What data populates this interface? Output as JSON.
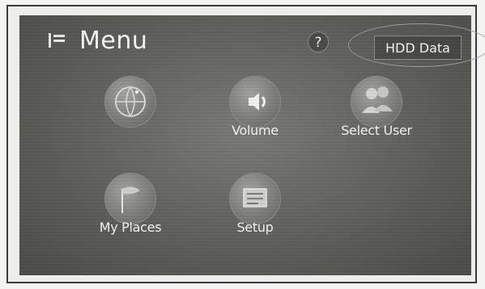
{
  "header": {
    "title": "Menu",
    "help_label": "?",
    "hdd_data_label": "HDD Data"
  },
  "menu_items": [
    {
      "id": "destination",
      "label": "",
      "icon": "globe-icon"
    },
    {
      "id": "volume",
      "label": "Volume",
      "icon": "speaker-icon"
    },
    {
      "id": "select_user",
      "label": "Select User",
      "icon": "user-icon"
    },
    {
      "id": "my_places",
      "label": "My Places",
      "icon": "flag-icon"
    },
    {
      "id": "setup",
      "label": "Setup",
      "icon": "settings-icon"
    }
  ],
  "colors": {
    "screen_bg": "#5f5f5a",
    "text": "#f2f2ee",
    "highlight_outline": "#9a9a96"
  }
}
